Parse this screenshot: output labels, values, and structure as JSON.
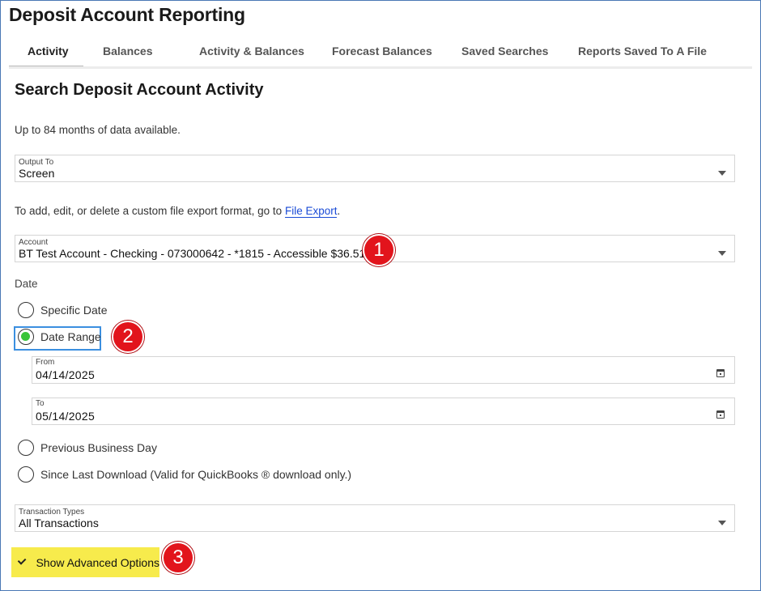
{
  "app": {
    "title": "Deposit Account Reporting"
  },
  "tabs": [
    {
      "label": "Activity",
      "active": true
    },
    {
      "label": "Balances",
      "active": false
    },
    {
      "label": "Activity & Balances",
      "active": false
    },
    {
      "label": "Forecast Balances",
      "active": false
    },
    {
      "label": "Saved Searches",
      "active": false
    },
    {
      "label": "Reports Saved To A File",
      "active": false
    }
  ],
  "main": {
    "title": "Search Deposit Account Activity",
    "availability_note": "Up to 84 months of data available.",
    "output_to": {
      "label": "Output To",
      "value": "Screen"
    },
    "export_note": {
      "prefix": "To add, edit, or delete a custom file export format, go to",
      "link": "File Export",
      "suffix": "."
    },
    "account": {
      "label": "Account",
      "value": "BT Test Account - Checking - 073000642 - *1815 - Accessible $36.51"
    },
    "date": {
      "label": "Date",
      "options": [
        {
          "label": "Specific Date",
          "checked": false
        },
        {
          "label": "Date Range",
          "checked": true
        },
        {
          "label": "Previous Business Day",
          "checked": false
        },
        {
          "label": "Since Last Download (Valid for QuickBooks ® download only.)",
          "checked": false
        }
      ],
      "from": {
        "label": "From",
        "value": "04/14/2025"
      },
      "to": {
        "label": "To",
        "value": "05/14/2025"
      }
    },
    "transaction_types": {
      "label": "Transaction Types",
      "value": "All Transactions"
    },
    "advanced_options_label": "Show Advanced Options"
  },
  "callouts": [
    "1",
    "2",
    "3"
  ],
  "colors": {
    "callout": "#e2141c",
    "highlight": "#f7eb4c",
    "focus": "#3b8fe0",
    "radio_checked": "#3ac43a",
    "link": "#1a4bd6"
  }
}
